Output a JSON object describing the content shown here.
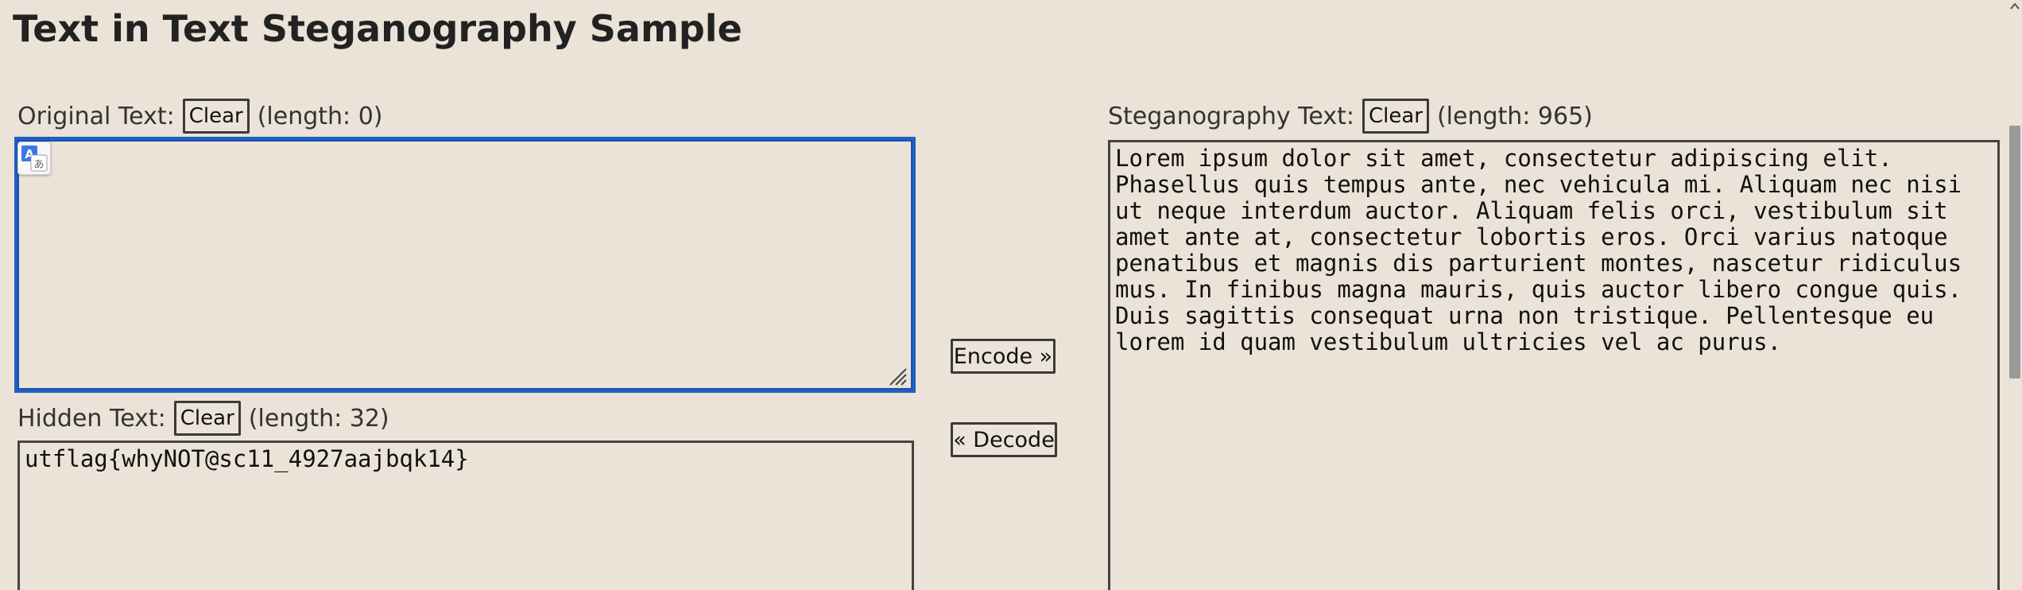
{
  "page": {
    "title": "Text in Text Steganography Sample"
  },
  "original": {
    "label": "Original Text:",
    "clear_label": "Clear",
    "length_text": "(length: 0)",
    "value": ""
  },
  "hidden": {
    "label": "Hidden Text:",
    "clear_label": "Clear",
    "length_text": "(length: 32)",
    "value": "utflag{whyNOT@sc11_4927aajbqk14}"
  },
  "steg": {
    "label": "Steganography Text:",
    "clear_label": "Clear",
    "length_text": "(length: 965)",
    "value": "Lorem ipsum dolor sit amet, consectetur adipiscing elit. Phasellus quis tempus ante, nec vehicula mi. Aliquam nec nisi ut neque interdum auctor. Aliquam felis orci, vestibulum sit amet ante at, consectetur lobortis eros. Orci varius natoque penatibus et magnis dis parturient montes, nascetur ridiculus mus. In finibus magna mauris, quis auctor libero congue quis. Duis sagittis consequat urna non tristique. Pellentesque eu lorem id quam vestibulum ultricies vel ac purus."
  },
  "actions": {
    "encode_label": "Encode »",
    "decode_label": "« Decode"
  },
  "icons": {
    "translate": "translate-icon",
    "resize": "resize-grip-icon"
  },
  "colors": {
    "background": "#ebe3d7",
    "focus_border": "#1f5fc4"
  }
}
